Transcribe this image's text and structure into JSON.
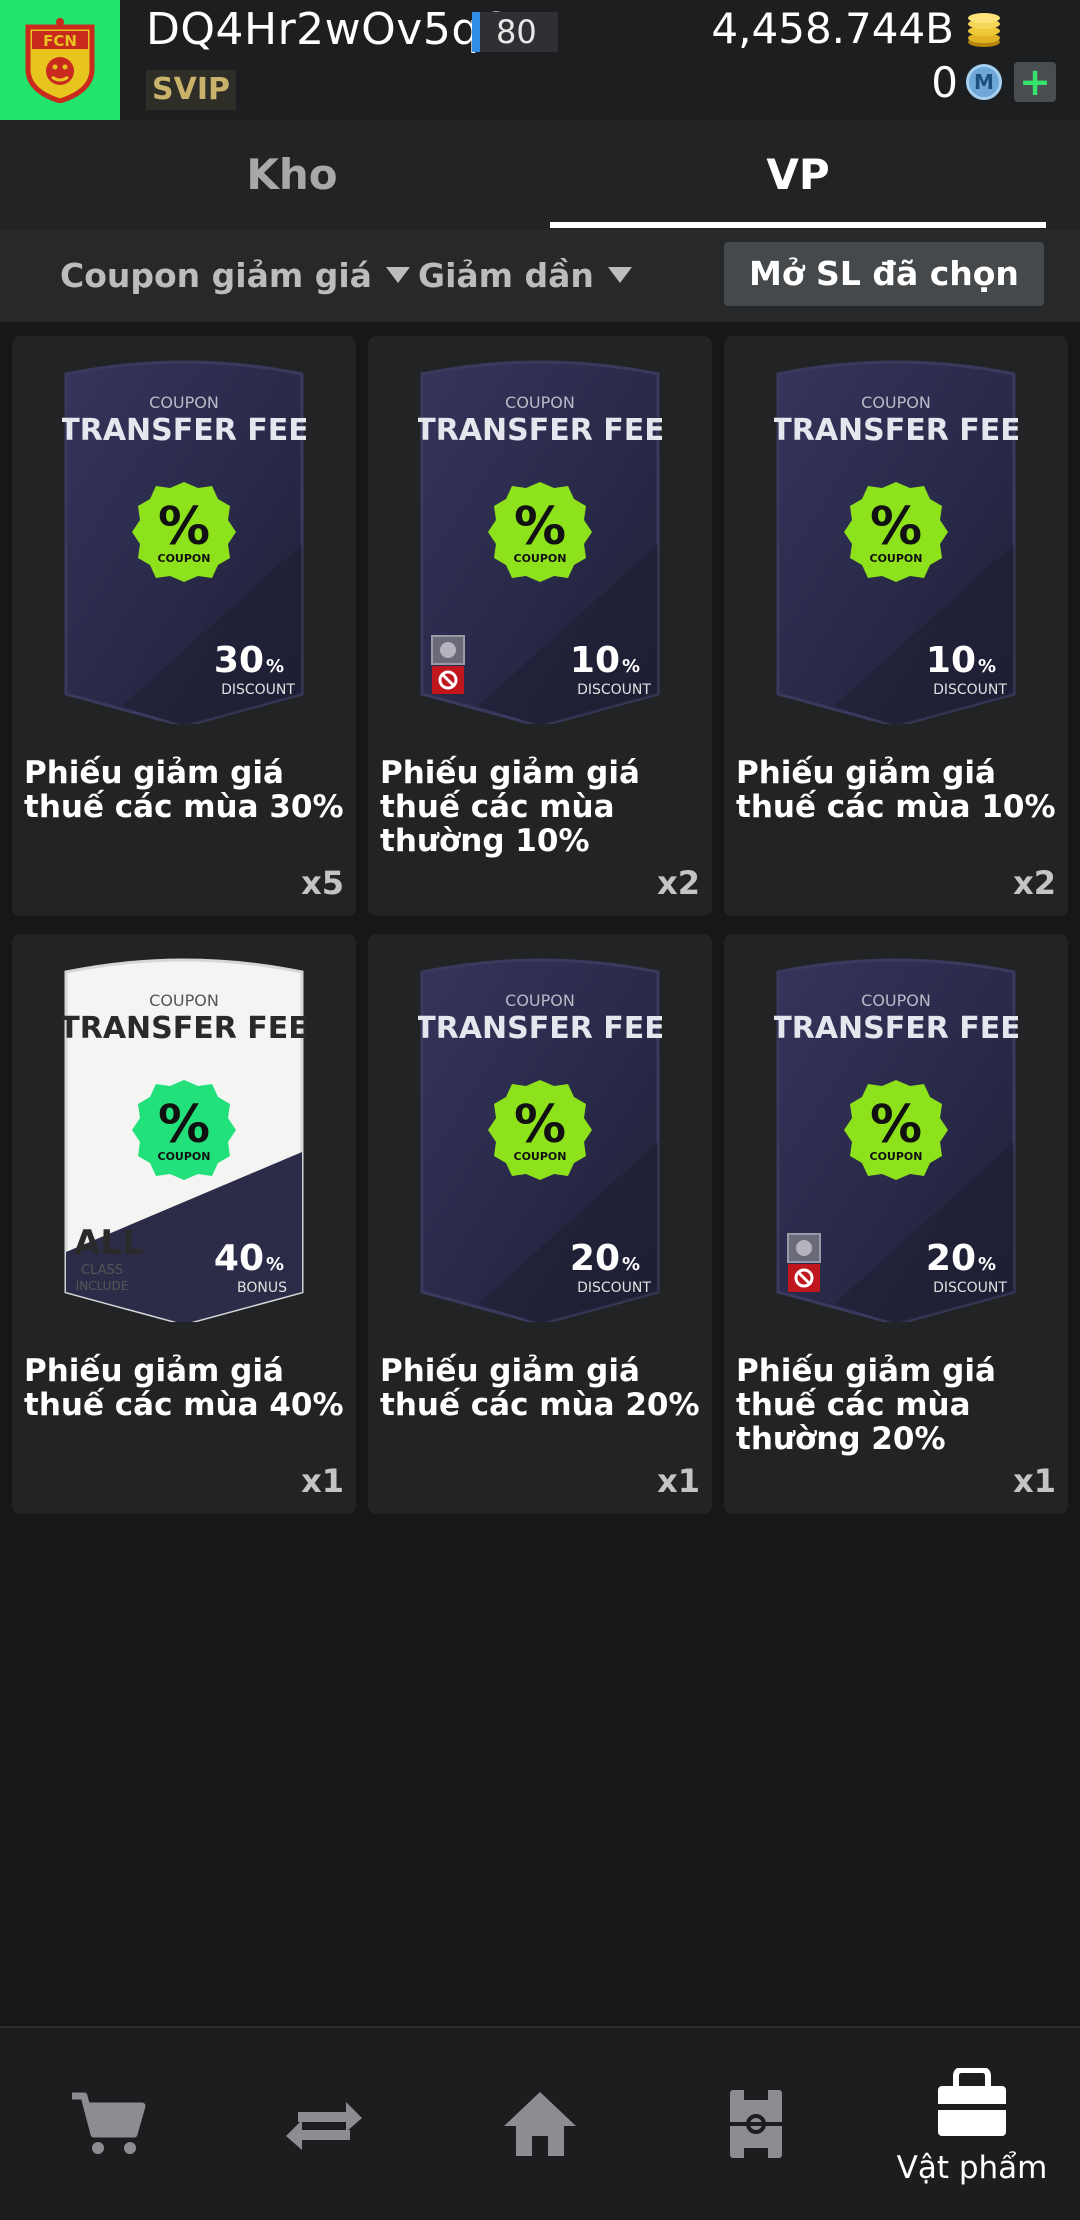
{
  "header": {
    "username": "DQ4Hr2wOv5q6z",
    "level": "80",
    "badge": "SVIP",
    "coins": "4,458.744B",
    "mpoints": "0",
    "mpoint_icon_letter": "M",
    "add_label": "+",
    "logo_text": "FCN"
  },
  "tabs": [
    {
      "label": "Kho",
      "active": false
    },
    {
      "label": "VP",
      "active": true
    }
  ],
  "filters": {
    "category": "Coupon giảm giá",
    "sort": "Giảm dần",
    "open_selected": "Mở SL đã chọn"
  },
  "coupon_art_text": {
    "header_small": "COUPON",
    "header_big": "TRANSFER FEE",
    "badge_symbol": "%",
    "badge_label": "COUPON",
    "discount_label": "DISCOUNT",
    "bonus_label": "BONUS",
    "percent_sign": "%",
    "all_label": "ALL",
    "class_label": "CLASS",
    "include_label": "INCLUDE"
  },
  "items": [
    {
      "name": "Phiếu giảm giá thuế các mùa 30%",
      "count": "x5",
      "percent": "30",
      "style": "dark",
      "restricted": false
    },
    {
      "name": "Phiếu giảm giá thuế các mùa thường 10%",
      "count": "x2",
      "percent": "10",
      "style": "dark",
      "restricted": true
    },
    {
      "name": "Phiếu giảm giá thuế các mùa 10%",
      "count": "x2",
      "percent": "10",
      "style": "dark",
      "restricted": false
    },
    {
      "name": "Phiếu giảm giá thuế các mùa 40%",
      "count": "x1",
      "percent": "40",
      "style": "white",
      "restricted": false
    },
    {
      "name": "Phiếu giảm giá thuế các mùa 20%",
      "count": "x1",
      "percent": "20",
      "style": "dark",
      "restricted": false
    },
    {
      "name": "Phiếu giảm giá thuế các mùa thường 20%",
      "count": "x1",
      "percent": "20",
      "style": "dark",
      "restricted": true
    }
  ],
  "bottom_nav": [
    {
      "icon": "cart-icon",
      "label": ""
    },
    {
      "icon": "transfer-arrows-icon",
      "label": ""
    },
    {
      "icon": "home-icon",
      "label": ""
    },
    {
      "icon": "squad-pitch-icon",
      "label": ""
    },
    {
      "icon": "bag-icon",
      "label": "Vật phẩm",
      "active": true
    }
  ],
  "colors": {
    "background": "#161718",
    "logo_bg": "#22e36b",
    "badge_green": "#8ee21c",
    "badge_green_bright": "#22e07a",
    "card_dark": "#2a2a4a",
    "accent_blue": "#2f8de6"
  }
}
